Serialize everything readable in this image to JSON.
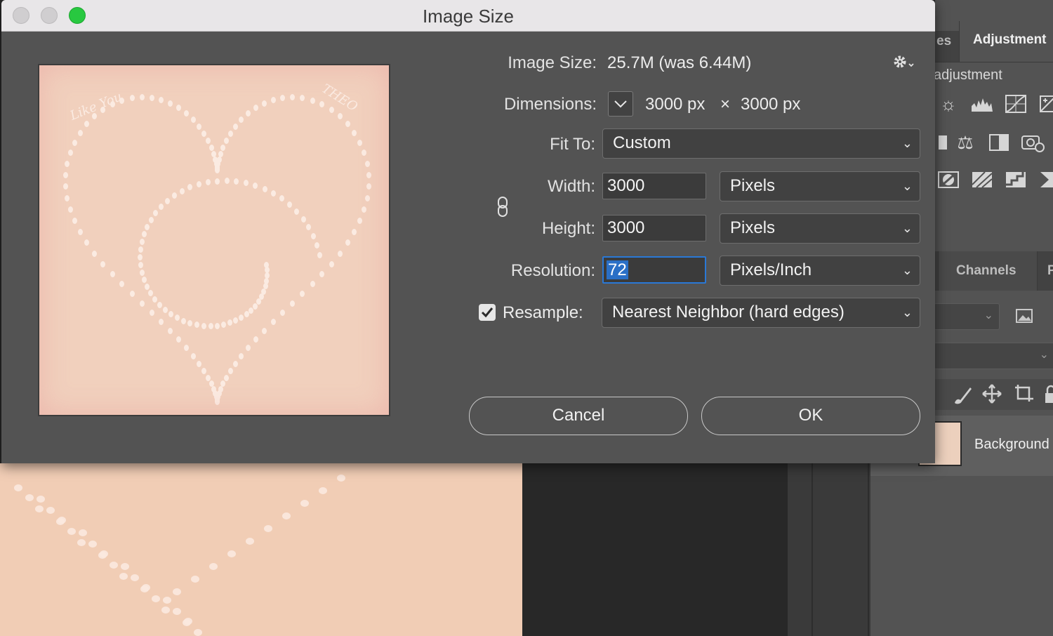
{
  "dialog": {
    "title": "Image Size",
    "image_size_label": "Image Size:",
    "image_size_value": "25.7M (was 6.44M)",
    "dimensions_label": "Dimensions:",
    "dimensions_width": "3000 px",
    "dimensions_sep": "×",
    "dimensions_height": "3000 px",
    "fit_to_label": "Fit To:",
    "fit_to_value": "Custom",
    "width_label": "Width:",
    "width_value": "3000",
    "width_unit": "Pixels",
    "height_label": "Height:",
    "height_value": "3000",
    "height_unit": "Pixels",
    "resolution_label": "Resolution:",
    "resolution_value": "72",
    "resolution_unit": "Pixels/Inch",
    "resample_label": "Resample:",
    "resample_checked": true,
    "resample_value": "Nearest Neighbor (hard edges)",
    "cancel_label": "Cancel",
    "ok_label": "OK",
    "preview_text_left": "Like You",
    "preview_text_right": "THEO"
  },
  "panels": {
    "tab_prev": "es",
    "tab_adjustments": "Adjustment",
    "adjustment_caption": "adjustment",
    "tab_channels": "Channels",
    "tab_next": "P",
    "layer_name": "Background"
  },
  "colors": {
    "dialog_bg": "#535353",
    "accent": "#2a6fc6",
    "maximize": "#28c840",
    "image": "#f1cdb5"
  },
  "icons": [
    "gear-icon",
    "chevron-down-icon",
    "link-icon",
    "checkbox-icon",
    "brightness-icon",
    "levels-icon",
    "curves-icon",
    "exposure-icon",
    "balance-icon",
    "bw-icon",
    "photo-filter-icon",
    "invert-icon",
    "posterize-icon",
    "threshold-icon",
    "gradient-map-icon",
    "brush-icon",
    "move-icon",
    "crop-icon",
    "lock-icon",
    "image-icon"
  ]
}
